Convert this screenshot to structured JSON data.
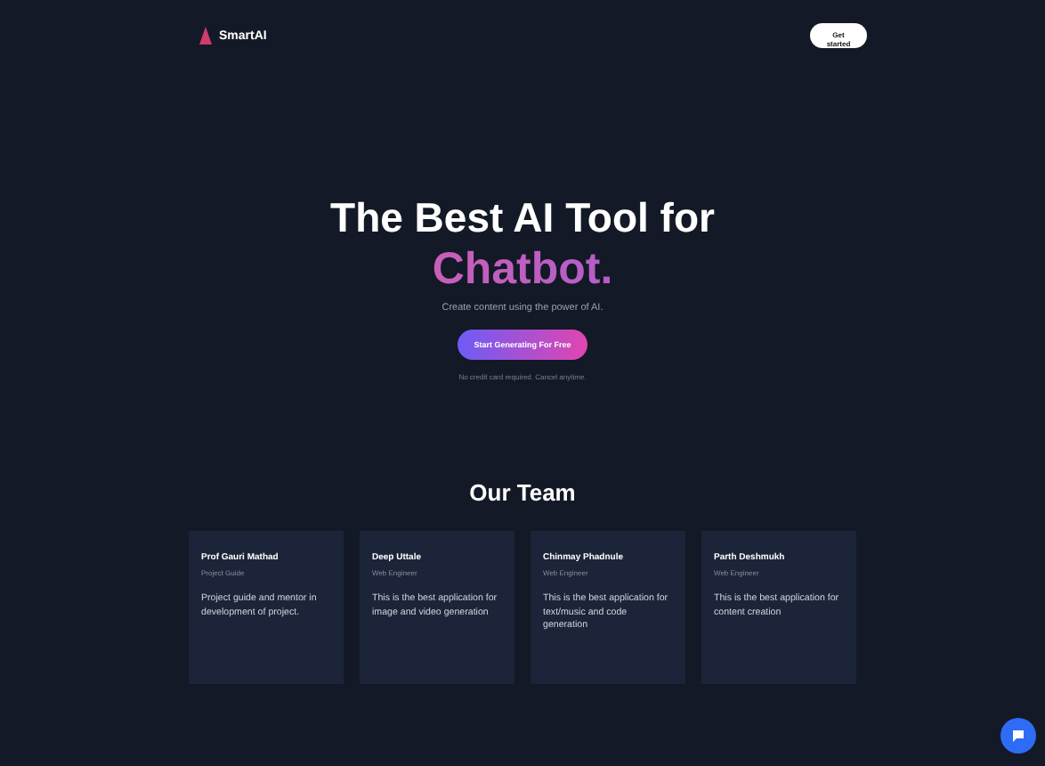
{
  "header": {
    "brand": "SmartAI",
    "action": "Get started"
  },
  "hero": {
    "title": "The Best AI Tool for",
    "highlight": "Chatbot.",
    "subtitle": "Create content using the power of AI.",
    "cta": "Start Generating For Free",
    "note": "No credit card required. Cancel anytime."
  },
  "team": {
    "heading": "Our Team",
    "members": [
      {
        "name": "Prof Gauri Mathad",
        "role": "Project Guide",
        "bio": "Project guide and mentor in development of project."
      },
      {
        "name": "Deep Uttale",
        "role": "Web Engineer",
        "bio": "This is the best application for image and video generation"
      },
      {
        "name": "Chinmay Phadnule",
        "role": "Web Engineer",
        "bio": "This is the best application for text/music and code generation"
      },
      {
        "name": "Parth Deshmukh",
        "role": "Web Engineer",
        "bio": "This is the best application for content creation"
      }
    ]
  }
}
